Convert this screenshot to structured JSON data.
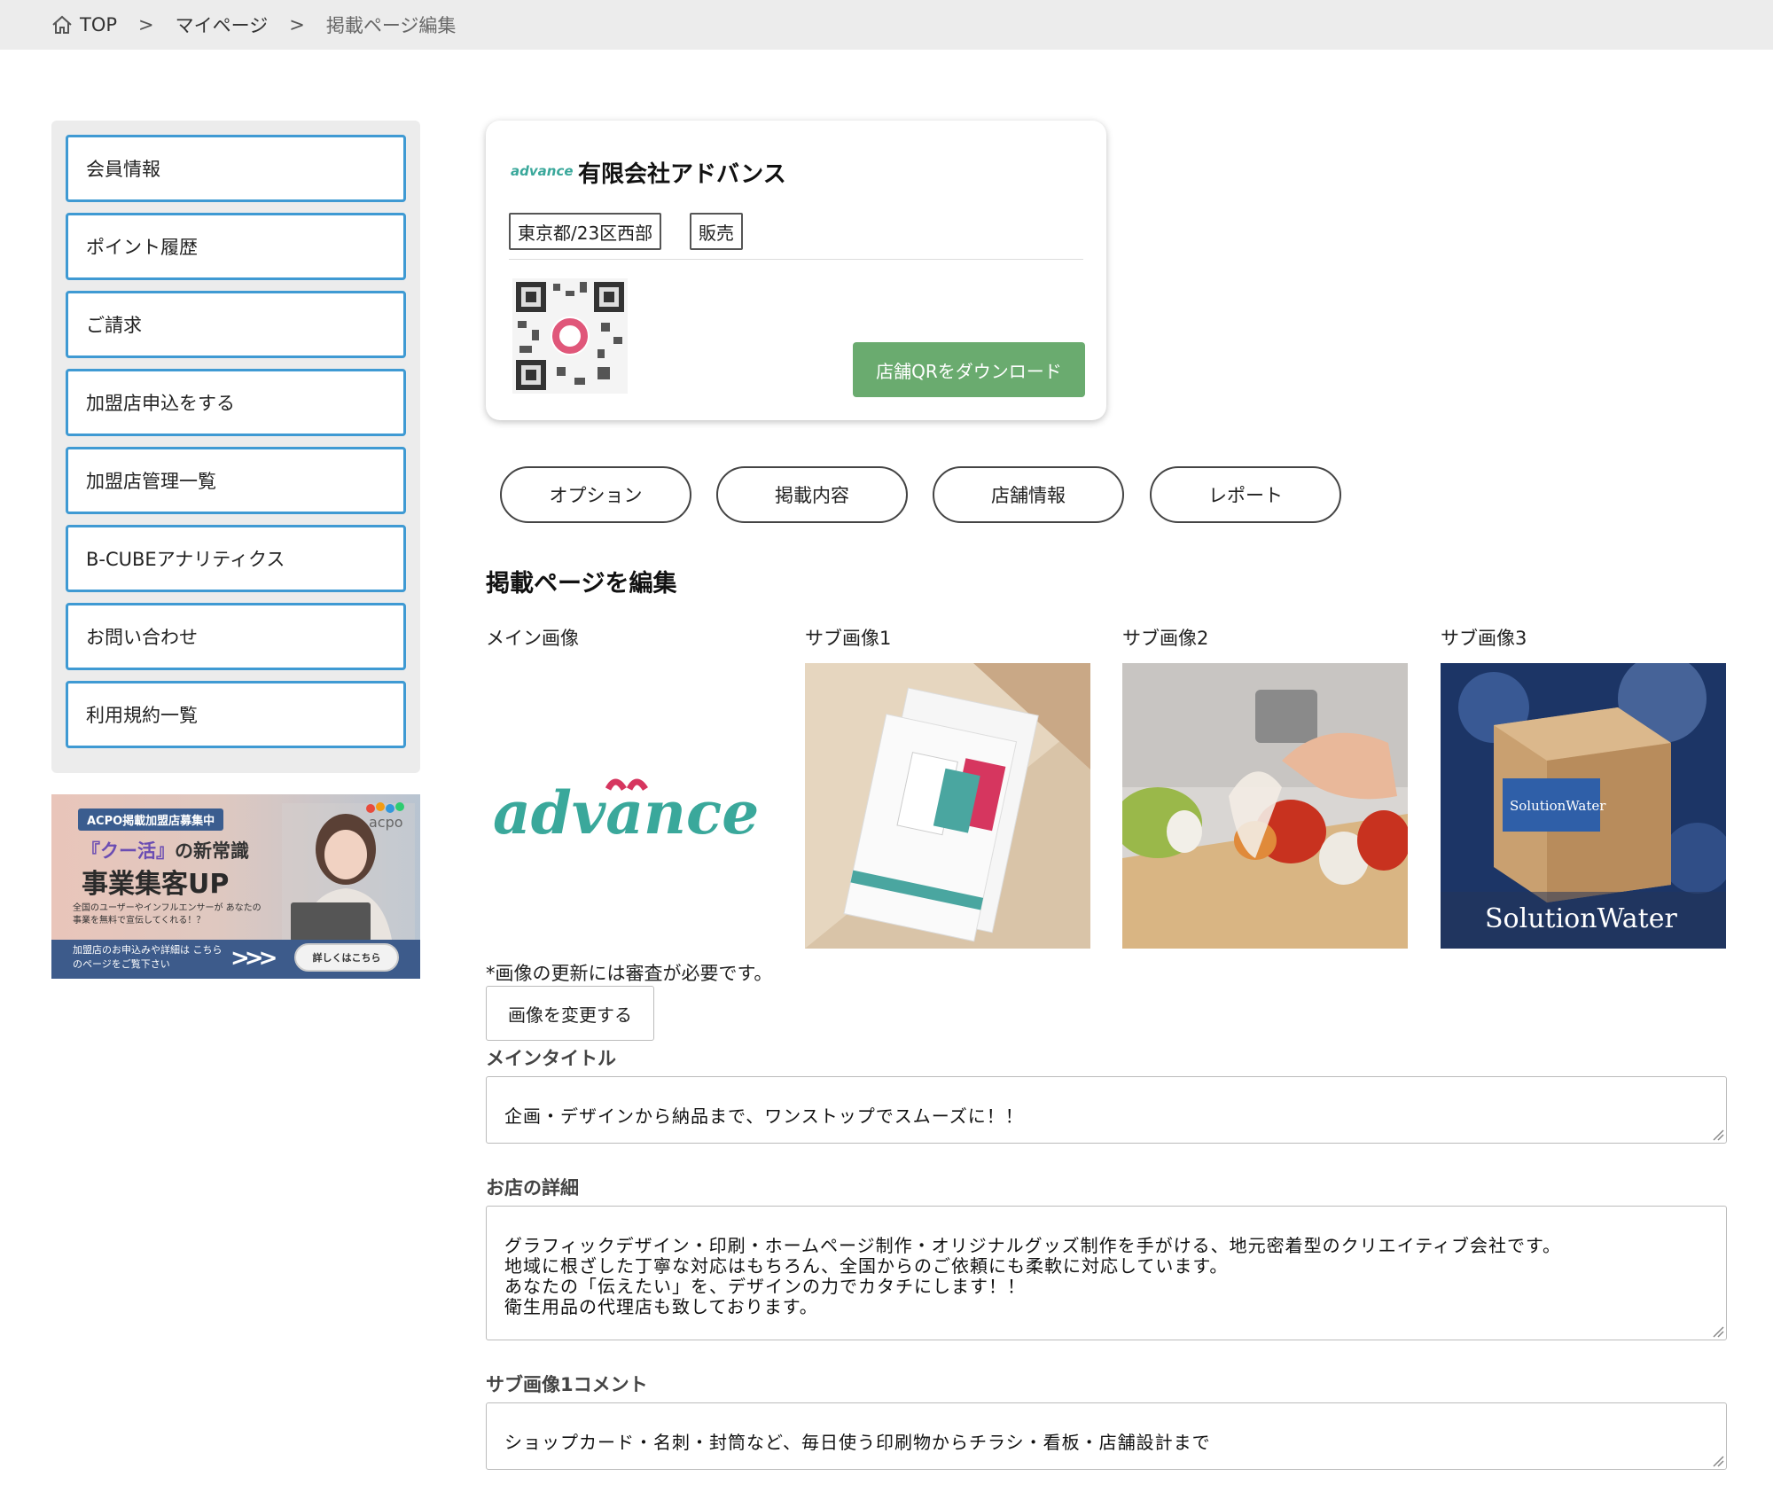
{
  "breadcrumb": {
    "home": "TOP",
    "sep": ">",
    "mypage": "マイページ",
    "current": "掲載ページ編集"
  },
  "sidebar": {
    "items": [
      {
        "label": "会員情報"
      },
      {
        "label": "ポイント履歴"
      },
      {
        "label": "ご請求"
      },
      {
        "label": "加盟店申込をする"
      },
      {
        "label": "加盟店管理一覧"
      },
      {
        "label": "B-CUBEアナリティクス"
      },
      {
        "label": "お問い合わせ"
      },
      {
        "label": "利用規約一覧"
      }
    ]
  },
  "banner": {
    "tag": "ACPO掲載加盟店募集中",
    "line1_highlight": "『クー活』",
    "line1_rest": "の新常識",
    "line2": "事業集客UP",
    "line3": "全国のユーザーやインフルエンサーが あなたの事業を無料で宣伝してくれる！？",
    "bottom_text": "加盟店のお申込みや詳細は こちらのページをご覧下さい",
    "more_button": "詳しくはこちら",
    "logo": "acpo"
  },
  "store": {
    "logo_text": "advance",
    "name": "有限会社アドバンス",
    "tags": [
      "東京都/23区西部",
      "販売"
    ],
    "qr_button": "店舗QRをダウンロード"
  },
  "tabs": [
    {
      "label": "オプション"
    },
    {
      "label": "掲載内容"
    },
    {
      "label": "店舗情報"
    },
    {
      "label": "レポート"
    }
  ],
  "edit": {
    "section_title": "掲載ページを編集",
    "image_labels": [
      "メイン画像",
      "サブ画像1",
      "サブ画像2",
      "サブ画像3"
    ],
    "main_logo": "advance",
    "sub3_text": "SolutionWater",
    "sub3_box_text": "SolutionWater",
    "note": "*画像の更新には審査が必要です。",
    "change_button": "画像を変更する",
    "main_title_label": "メインタイトル",
    "main_title_value": "企画・デザインから納品まで、ワンストップでスムーズに！！",
    "detail_label": "お店の詳細",
    "detail_value": "グラフィックデザイン・印刷・ホームページ制作・オリジナルグッズ制作を手がける、地元密着型のクリエイティブ会社です。\n地域に根ざした丁寧な対応はもちろん、全国からのご依頼にも柔軟に対応しています。\nあなたの「伝えたい」を、デザインの力でカタチにします！！\n衛生用品の代理店も致しております。",
    "sub1_comment_label": "サブ画像1コメント",
    "sub1_comment_value": "ショップカード・名刺・封筒など、毎日使う印刷物からチラシ・看板・店舗設計まで"
  },
  "colors": {
    "sidebar_border": "#3f9ad3",
    "qr_button": "#6aab6f",
    "logo_teal": "#3aa89b",
    "logo_pink": "#d6365f"
  }
}
